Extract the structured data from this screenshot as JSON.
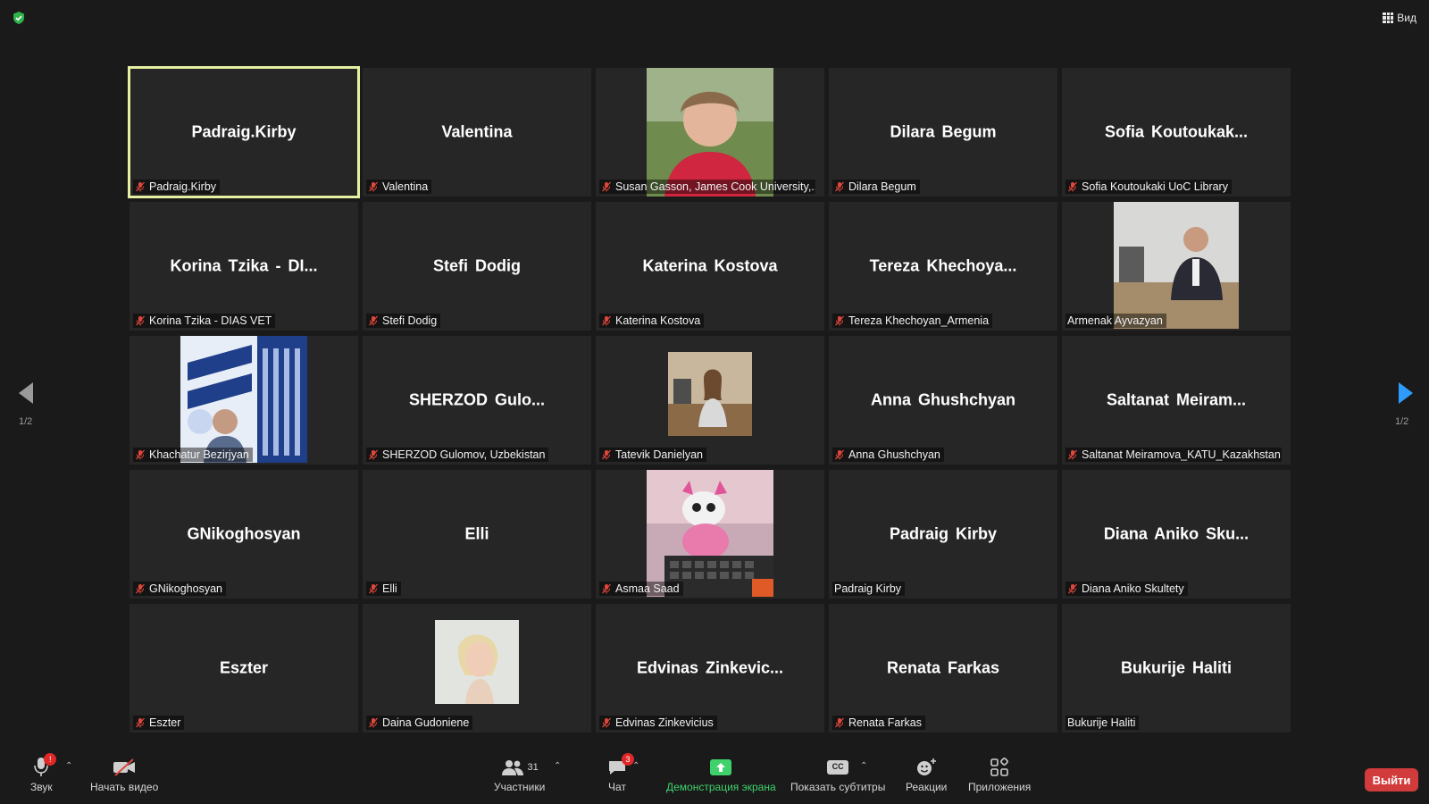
{
  "top": {
    "view_label": "Вид"
  },
  "pagination": {
    "left_page": "1/2",
    "right_page": "1/2"
  },
  "tiles": [
    {
      "center": "Padraig.Kirby",
      "label": "Padraig.Kirby",
      "muted": true,
      "active": true
    },
    {
      "center": "Valentina",
      "label": "Valentina",
      "muted": true
    },
    {
      "center": "",
      "label": "Susan Gasson, James Cook University,...",
      "muted": true,
      "photo": "woman-portrait"
    },
    {
      "center": "Dilara Begum",
      "label": "Dilara Begum",
      "muted": true
    },
    {
      "center": "Sofia  Koutoukak...",
      "label": "Sofia Koutoukaki UoC Library",
      "muted": true
    },
    {
      "center": "Korina Tzika - DI...",
      "label": "Korina Tzika - DIAS VET",
      "muted": true
    },
    {
      "center": "Stefi Dodig",
      "label": "Stefi Dodig",
      "muted": true
    },
    {
      "center": "Katerina Kostova",
      "label": "Katerina Kostova",
      "muted": true
    },
    {
      "center": "Tereza  Khechoya...",
      "label": "Tereza Khechoyan_Armenia",
      "muted": true
    },
    {
      "center": "",
      "label": "Armenak Ayvazyan",
      "muted": false,
      "photo": "man-at-desk"
    },
    {
      "center": "",
      "label": "Khachatur Bezirjyan",
      "muted": true,
      "photo": "logo-banner"
    },
    {
      "center": "SHERZOD  Gulo...",
      "label": "SHERZOD Gulomov, Uzbekistan",
      "muted": true
    },
    {
      "center": "",
      "label": "Tatevik Danielyan",
      "muted": true,
      "photo": "woman-office"
    },
    {
      "center": "Anna Ghushchyan",
      "label": "Anna Ghushchyan",
      "muted": true
    },
    {
      "center": "Saltanat  Meiram...",
      "label": "Saltanat Meiramova_KATU_Kazakhstan",
      "muted": true
    },
    {
      "center": "GNikoghosyan",
      "label": "GNikoghosyan",
      "muted": true
    },
    {
      "center": "Elli",
      "label": "Elli",
      "muted": true
    },
    {
      "center": "",
      "label": "Asmaa Saad",
      "muted": true,
      "photo": "toy-keyboard"
    },
    {
      "center": "Padraig Kirby",
      "label": "Padraig Kirby",
      "muted": false
    },
    {
      "center": "Diana  Aniko  Sku...",
      "label": "Diana Aniko Skultety",
      "muted": true
    },
    {
      "center": "Eszter",
      "label": "Eszter",
      "muted": true
    },
    {
      "center": "",
      "label": "Daina Gudoniene",
      "muted": true,
      "photo": "blonde-portrait"
    },
    {
      "center": "Edvinas  Zinkevic...",
      "label": "Edvinas Zinkevicius",
      "muted": true
    },
    {
      "center": "Renata Farkas",
      "label": "Renata Farkas",
      "muted": true
    },
    {
      "center": "Bukurije Haliti",
      "label": "Bukurije Haliti",
      "muted": false
    }
  ],
  "toolbar": {
    "audio_label": "Звук",
    "audio_badge": "!",
    "video_label": "Начать видео",
    "participants_label": "Участники",
    "participants_count": "31",
    "chat_label": "Чат",
    "chat_badge": "3",
    "share_label": "Демонстрация экрана",
    "captions_label": "Показать субтитры",
    "captions_icon_text": "CC",
    "reactions_label": "Реакции",
    "apps_label": "Приложения",
    "leave_label": "Выйти"
  },
  "colors": {
    "active_border": "#e6f0a0",
    "mute_red": "#e0463c",
    "share_green": "#3fd26b",
    "leave_red": "#d23b3b",
    "arrow_blue": "#2f9bff"
  }
}
